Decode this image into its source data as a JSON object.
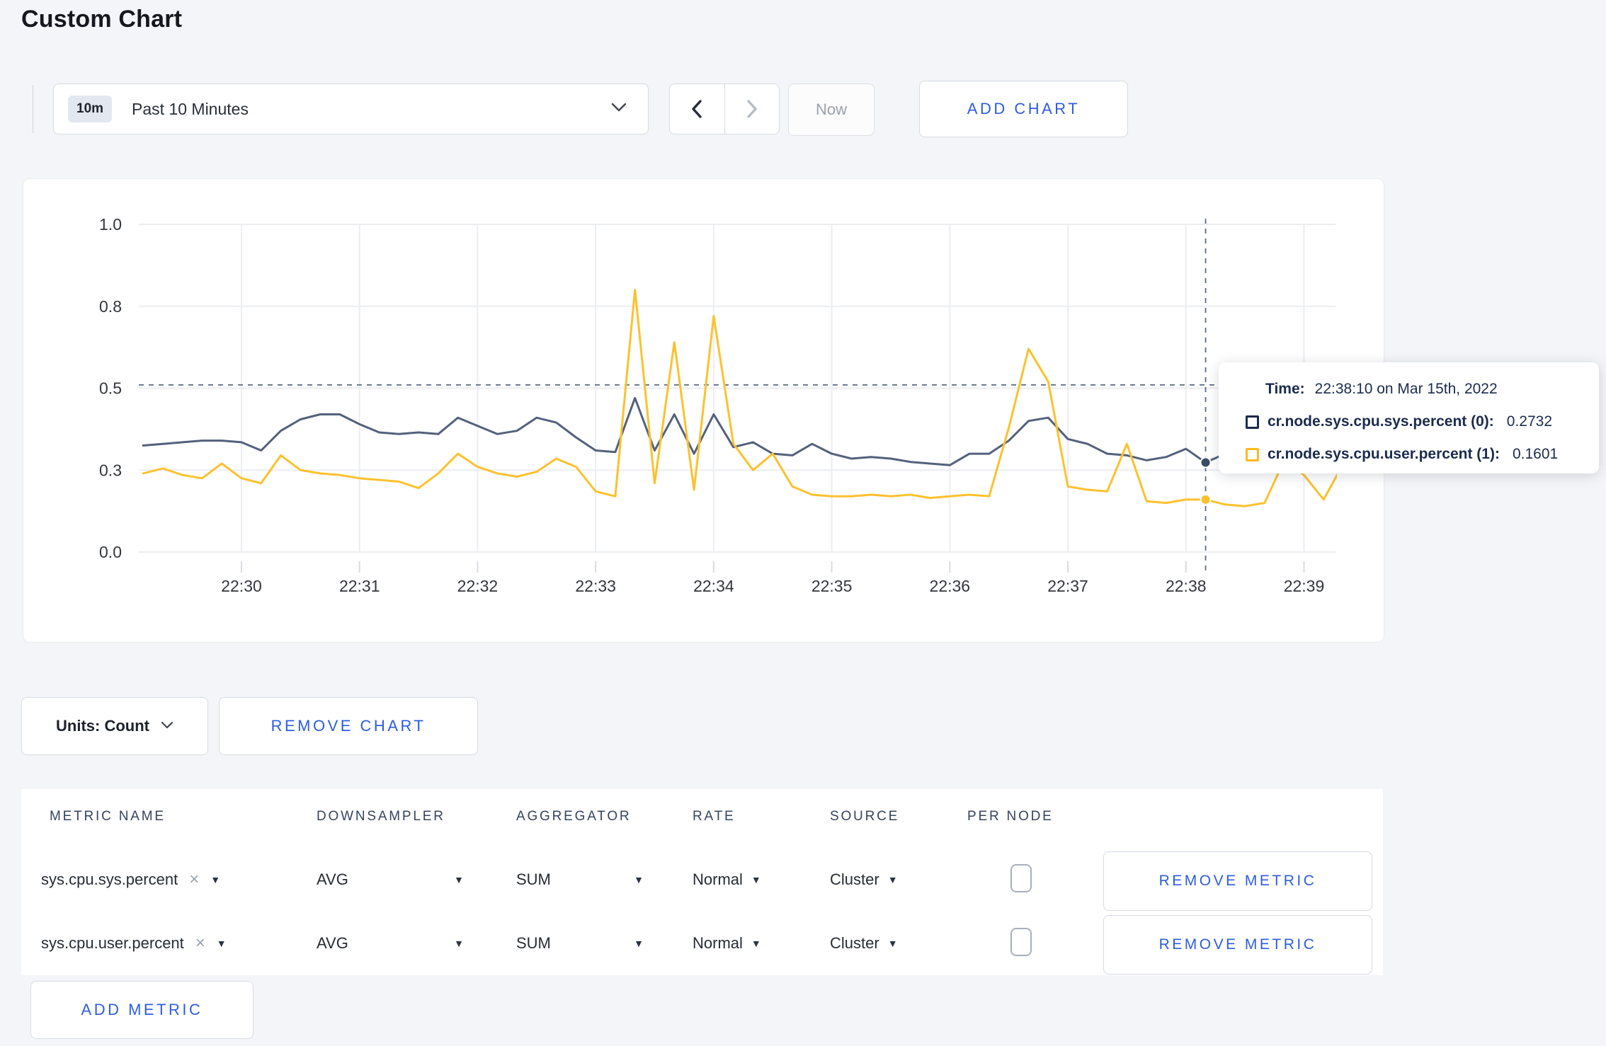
{
  "page": {
    "title": "Custom Chart"
  },
  "toolbar": {
    "range_badge": "10m",
    "range_label": "Past 10 Minutes",
    "now_label": "Now",
    "add_chart_label": "ADD CHART"
  },
  "chart_data": {
    "type": "line",
    "title": "",
    "xlabel": "",
    "ylabel": "",
    "ylim": [
      0,
      1
    ],
    "grid": true,
    "y_ticks": [
      {
        "v": 0.0,
        "label": "0.0"
      },
      {
        "v": 0.25,
        "label": "0.3"
      },
      {
        "v": 0.5,
        "label": "0.5"
      },
      {
        "v": 0.75,
        "label": "0.8"
      },
      {
        "v": 1.0,
        "label": "1.0"
      }
    ],
    "x_tick_labels": [
      "22:30",
      "22:31",
      "22:32",
      "22:33",
      "22:34",
      "22:35",
      "22:36",
      "22:37",
      "22:38",
      "22:39"
    ],
    "t_start_label": "22:29:10",
    "t_step_seconds": 10,
    "series": [
      {
        "name": "cr.node.sys.cpu.sys.percent",
        "color": "#53617c",
        "values": [
          0.325,
          0.33,
          0.335,
          0.34,
          0.34,
          0.335,
          0.31,
          0.37,
          0.405,
          0.42,
          0.42,
          0.39,
          0.365,
          0.36,
          0.365,
          0.36,
          0.41,
          0.385,
          0.36,
          0.37,
          0.41,
          0.395,
          0.35,
          0.31,
          0.305,
          0.47,
          0.31,
          0.42,
          0.3,
          0.42,
          0.32,
          0.335,
          0.3,
          0.295,
          0.33,
          0.3,
          0.285,
          0.29,
          0.285,
          0.275,
          0.27,
          0.265,
          0.3,
          0.3,
          0.34,
          0.4,
          0.41,
          0.345,
          0.33,
          0.3,
          0.295,
          0.28,
          0.29,
          0.315,
          0.2732,
          0.3,
          0.295,
          0.3,
          0.295,
          0.3,
          0.305,
          0.31
        ]
      },
      {
        "name": "cr.node.sys.cpu.user.percent",
        "color": "#fcc12e",
        "values": [
          0.24,
          0.255,
          0.235,
          0.225,
          0.27,
          0.225,
          0.21,
          0.295,
          0.25,
          0.24,
          0.235,
          0.225,
          0.22,
          0.215,
          0.195,
          0.24,
          0.3,
          0.26,
          0.24,
          0.23,
          0.245,
          0.285,
          0.26,
          0.185,
          0.17,
          0.8,
          0.21,
          0.64,
          0.19,
          0.72,
          0.33,
          0.25,
          0.3,
          0.2,
          0.175,
          0.17,
          0.17,
          0.175,
          0.17,
          0.175,
          0.165,
          0.17,
          0.175,
          0.17,
          0.38,
          0.62,
          0.52,
          0.2,
          0.19,
          0.185,
          0.33,
          0.155,
          0.15,
          0.16,
          0.1601,
          0.145,
          0.14,
          0.15,
          0.28,
          0.235,
          0.16,
          0.27
        ]
      }
    ],
    "legend_position": "none",
    "crosshair": {
      "t_seconds": 540,
      "time_label": "22:38:10",
      "h_value": 0.51,
      "highlight_values": [
        0.2732,
        0.1601
      ]
    }
  },
  "tooltip": {
    "time_label": "Time:",
    "time_value": "22:38:10 on Mar 15th, 2022",
    "rows": [
      {
        "name": "cr.node.sys.cpu.sys.percent (0):",
        "value": "0.2732",
        "swatch": "#1b2b4e"
      },
      {
        "name": "cr.node.sys.cpu.user.percent (1):",
        "value": "0.1601",
        "swatch": "#fdb81e"
      }
    ]
  },
  "units_bar": {
    "units_label": "Units: Count",
    "remove_chart_label": "REMOVE CHART"
  },
  "metrics_table": {
    "headers": [
      "METRIC NAME",
      "DOWNSAMPLER",
      "AGGREGATOR",
      "RATE",
      "SOURCE",
      "PER NODE"
    ],
    "rows": [
      {
        "metric": "sys.cpu.sys.percent",
        "close": "×",
        "downsampler": "AVG",
        "aggregator": "SUM",
        "rate": "Normal",
        "source": "Cluster",
        "per_node_checked": false,
        "remove_label": "REMOVE METRIC"
      },
      {
        "metric": "sys.cpu.user.percent",
        "close": "×",
        "downsampler": "AVG",
        "aggregator": "SUM",
        "rate": "Normal",
        "source": "Cluster",
        "per_node_checked": false,
        "remove_label": "REMOVE METRIC"
      }
    ],
    "add_metric_label": "ADD METRIC",
    "caret_glyph": "▼"
  },
  "colors": {
    "accent_blue": "#2d5cdf",
    "grid_line": "#ebedf1",
    "crosshair": "#5a6b84",
    "page_bg": "#f4f5f8"
  }
}
